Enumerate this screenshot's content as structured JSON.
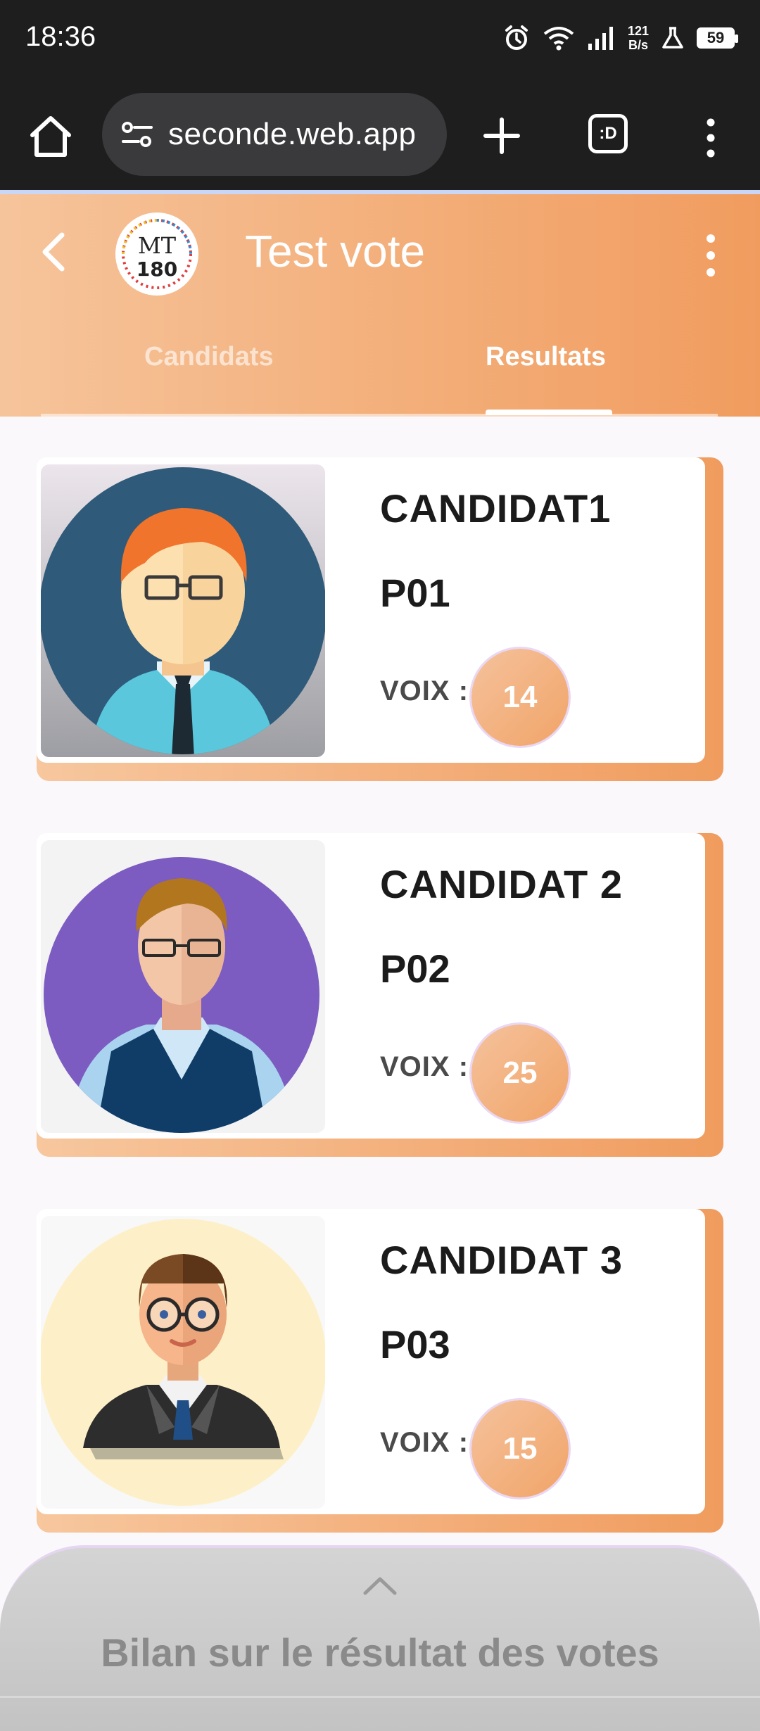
{
  "status_bar": {
    "time": "18:36",
    "net_speed_value": "121",
    "net_speed_unit": "B/s",
    "battery": "59"
  },
  "browser": {
    "url": "seconde.web.app",
    "tabs_icon_label": ":D"
  },
  "app": {
    "title": "Test vote",
    "logo_text_top": "MT",
    "logo_text_bottom": "180",
    "tabs": [
      {
        "label": "Candidats",
        "active": false
      },
      {
        "label": "Resultats",
        "active": true
      }
    ],
    "accent_color": "#f3ae79"
  },
  "candidates": [
    {
      "name": "CANDIDAT1",
      "code": "P01",
      "votes_label": "VOIX :",
      "votes": "14",
      "avatar": "man-red-hair-glasses-tie"
    },
    {
      "name": "CANDIDAT 2",
      "code": "P02",
      "votes_label": "VOIX :",
      "votes": "25",
      "avatar": "man-vest-glasses"
    },
    {
      "name": "CANDIDAT 3",
      "code": "P03",
      "votes_label": "VOIX :",
      "votes": "15",
      "avatar": "man-suit-round-glasses"
    }
  ],
  "bottom_sheet": {
    "title": "Bilan sur le résultat des votes"
  }
}
